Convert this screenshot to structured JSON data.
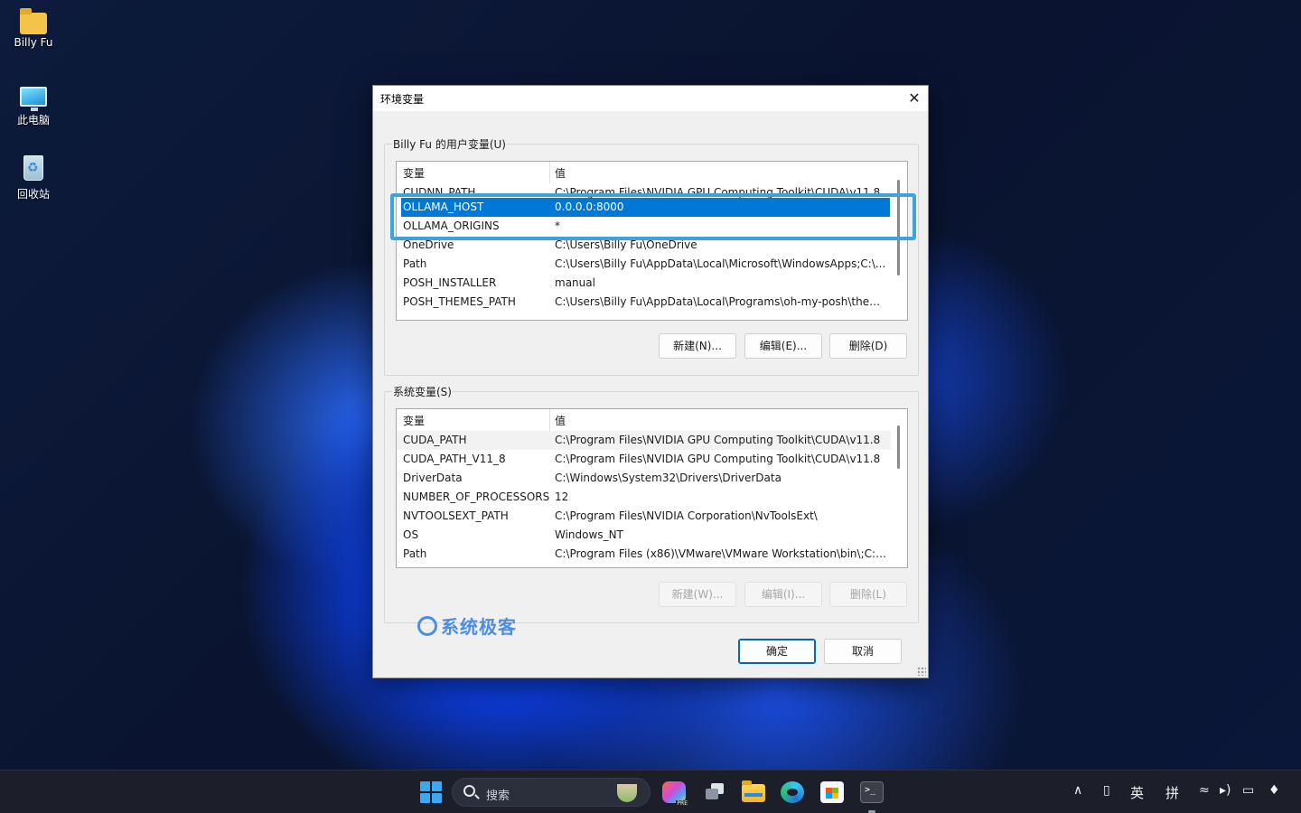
{
  "desktop": {
    "icons": [
      {
        "label": "Billy Fu",
        "icon": "folder-icon"
      },
      {
        "label": "此电脑",
        "icon": "computer-icon"
      },
      {
        "label": "回收站",
        "icon": "recycle-bin-icon"
      }
    ]
  },
  "dialog": {
    "title": "环境变量",
    "close_glyph": "✕",
    "user_vars": {
      "label": "Billy Fu 的用户变量(U)",
      "header": {
        "name": "变量",
        "value": "值"
      },
      "rows": [
        {
          "name": "CUDNN_PATH",
          "value": "C:\\Program Files\\NVIDIA GPU Computing Toolkit\\CUDA\\v11.8"
        },
        {
          "name": "OLLAMA_HOST",
          "value": "0.0.0.0:8000"
        },
        {
          "name": "OLLAMA_ORIGINS",
          "value": "*"
        },
        {
          "name": "OneDrive",
          "value": "C:\\Users\\Billy Fu\\OneDrive"
        },
        {
          "name": "Path",
          "value": "C:\\Users\\Billy Fu\\AppData\\Local\\Microsoft\\WindowsApps;C:\\..."
        },
        {
          "name": "POSH_INSTALLER",
          "value": "manual"
        },
        {
          "name": "POSH_THEMES_PATH",
          "value": "C:\\Users\\Billy Fu\\AppData\\Local\\Programs\\oh-my-posh\\them..."
        }
      ],
      "selected_row": "OLLAMA_HOST",
      "buttons": {
        "new": "新建(N)...",
        "edit": "编辑(E)...",
        "delete": "删除(D)"
      }
    },
    "system_vars": {
      "label": "系统变量(S)",
      "header": {
        "name": "变量",
        "value": "值"
      },
      "rows": [
        {
          "name": "CUDA_PATH",
          "value": "C:\\Program Files\\NVIDIA GPU Computing Toolkit\\CUDA\\v11.8"
        },
        {
          "name": "CUDA_PATH_V11_8",
          "value": "C:\\Program Files\\NVIDIA GPU Computing Toolkit\\CUDA\\v11.8"
        },
        {
          "name": "DriverData",
          "value": "C:\\Windows\\System32\\Drivers\\DriverData"
        },
        {
          "name": "NUMBER_OF_PROCESSORS",
          "value": "12"
        },
        {
          "name": "NVTOOLSEXT_PATH",
          "value": "C:\\Program Files\\NVIDIA Corporation\\NvToolsExt\\"
        },
        {
          "name": "OS",
          "value": "Windows_NT"
        },
        {
          "name": "Path",
          "value": "C:\\Program Files (x86)\\VMware\\VMware Workstation\\bin\\;C:\\..."
        }
      ],
      "buttons": {
        "new": "新建(W)...",
        "edit": "编辑(I)...",
        "delete": "删除(L)"
      }
    },
    "ok_label": "确定",
    "cancel_label": "取消"
  },
  "watermark": {
    "text": "系统极客"
  },
  "taskbar": {
    "search_placeholder": "搜索",
    "apps": [
      "copilot-icon",
      "task-view-icon",
      "file-explorer-icon",
      "edge-icon",
      "store-icon",
      "terminal-icon"
    ],
    "tray": {
      "chevron": "∧",
      "ime_lang": "英",
      "ime_mode": "拼",
      "wifi": "wifi-icon",
      "volume": "volume-icon",
      "battery": "battery-icon",
      "notifications": "bell-icon"
    }
  },
  "colors": {
    "selection": "#0078d7",
    "highlight_border": "#3ea2dc",
    "dialog_bg": "#f0f0f0"
  }
}
